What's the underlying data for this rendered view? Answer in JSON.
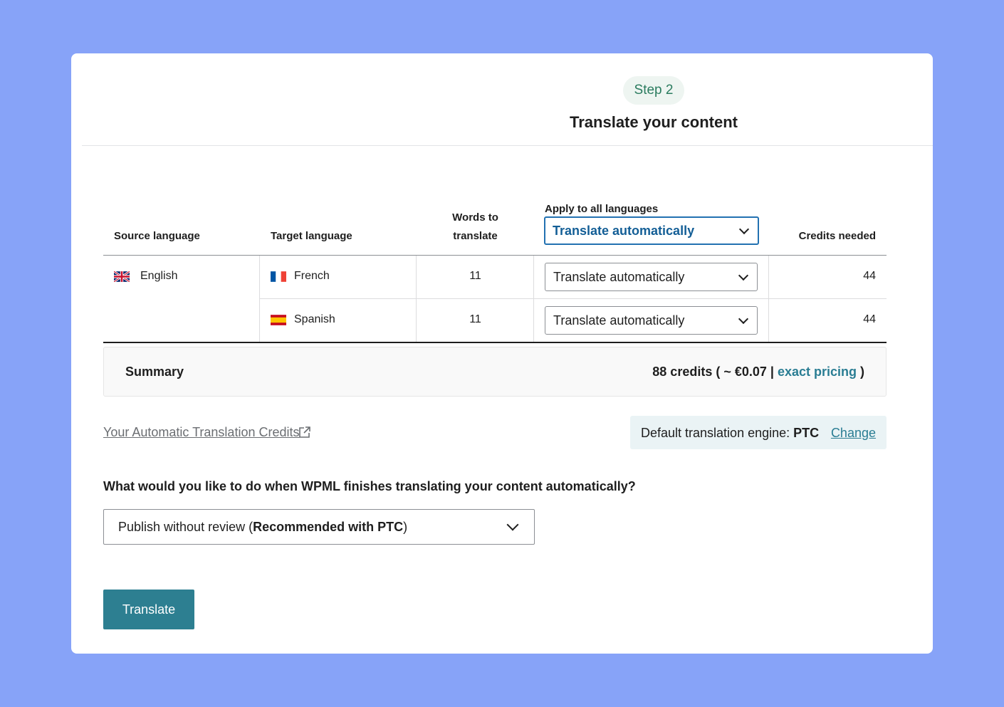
{
  "header": {
    "step": "Step 2",
    "title": "Translate your content"
  },
  "table": {
    "columns": {
      "source": "Source language",
      "target": "Target language",
      "words_line1": "Words to",
      "words_line2": "translate",
      "apply_all": "Apply to all languages",
      "credits": "Credits needed"
    },
    "apply_all_value": "Translate automatically",
    "source_language": "English",
    "rows": [
      {
        "target": "French",
        "words": "11",
        "method": "Translate automatically",
        "credits": "44"
      },
      {
        "target": "Spanish",
        "words": "11",
        "method": "Translate automatically",
        "credits": "44"
      }
    ]
  },
  "summary": {
    "label": "Summary",
    "credits_prefix": "88 credits ( ~ €0.07 |",
    "link": "exact pricing",
    "suffix": ")"
  },
  "credits_link": "Your Automatic Translation Credits",
  "engine": {
    "label": "Default translation engine:",
    "value": "PTC",
    "change": "Change"
  },
  "question": "What would you like to do when WPML finishes translating your content automatically?",
  "publish_select": {
    "text": "Publish without review (",
    "bold": "Recommended with PTC",
    "suffix": ")"
  },
  "translate_button": "Translate",
  "colors": {
    "background": "#87a3f8",
    "accent": "#2d7f91",
    "link": "#2a7d93",
    "focus": "#2271b1"
  }
}
